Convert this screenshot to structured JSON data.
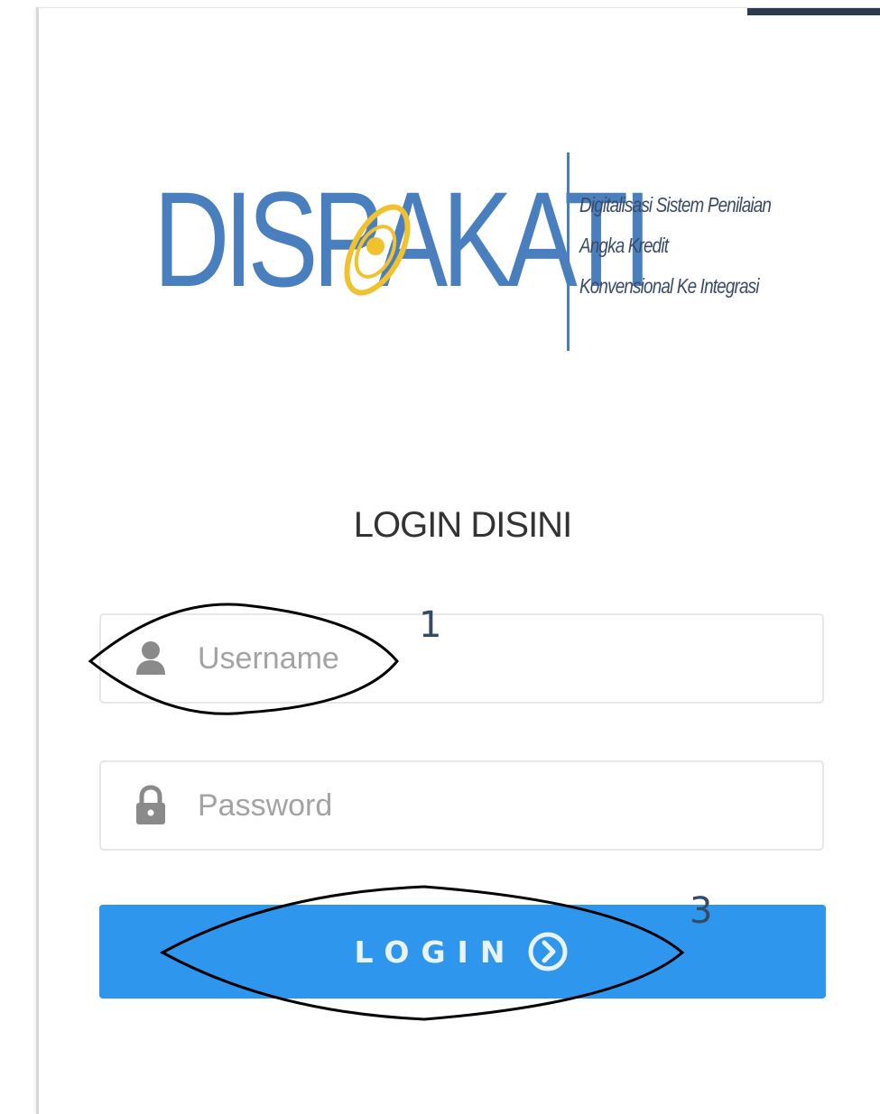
{
  "logo": {
    "wordmark_before": "DISP",
    "wordmark_after": "KATI",
    "tagline": [
      "Digitalisasi Sistem Penilaian",
      "Angka Kredit",
      "Konvensional Ke Integrasi"
    ],
    "brand_color": "#4a7fbf",
    "emblem_color": "#f2c12e"
  },
  "heading": "LOGIN DISINI",
  "username": {
    "placeholder": "Username",
    "value": "",
    "icon": "user-icon"
  },
  "password": {
    "placeholder": "Password",
    "value": "",
    "icon": "lock-icon"
  },
  "login_button": {
    "label": "LOGIN",
    "icon": "chevron-circle-right-icon",
    "color": "#2e96ed"
  },
  "annotations": [
    {
      "label": "1",
      "target": "username"
    },
    {
      "label": "3",
      "target": "login_button"
    }
  ]
}
